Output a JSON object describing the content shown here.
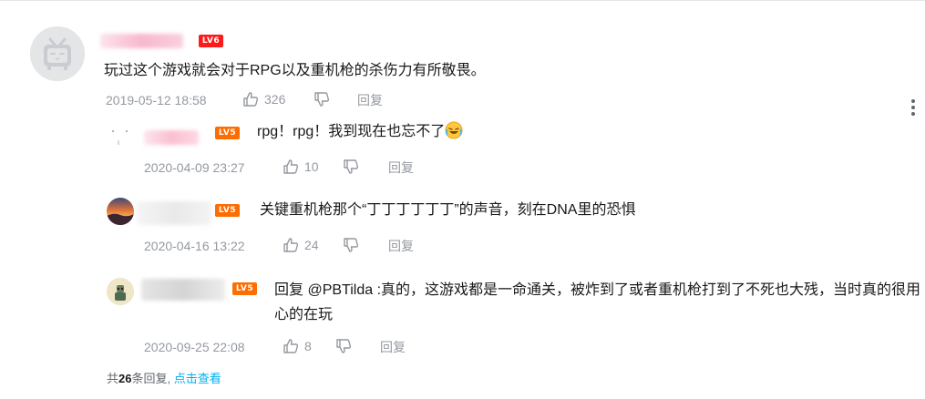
{
  "main_comment": {
    "level": "LV6",
    "content": "玩过这个游戏就会对于RPG以及重机枪的杀伤力有所敬畏。",
    "time": "2019-05-12 18:58",
    "likes": "326",
    "reply_label": "回复"
  },
  "replies": [
    {
      "level": "LV5",
      "content": "rpg！rpg！我到现在也忘不了",
      "emoji": "laughing-crying-emoji",
      "time": "2020-04-09 23:27",
      "likes": "10",
      "reply_label": "回复"
    },
    {
      "level": "LV5",
      "content": "关键重机枪那个“丁丁丁丁丁丁”的声音，刻在DNA里的恐惧",
      "time": "2020-04-16 13:22",
      "likes": "24",
      "reply_label": "回复"
    },
    {
      "level": "LV5",
      "content": "回复 @PBTilda :真的，这游戏都是一命通关，被炸到了或者重机枪打到了不死也大残，当时真的很用心的在玩",
      "time": "2020-09-25 22:08",
      "likes": "8",
      "reply_label": "回复"
    }
  ],
  "summary": {
    "prefix": "共",
    "count": "26",
    "suffix": "条回复,",
    "view_link": "点击查看"
  },
  "colors": {
    "accent": "#00aeec",
    "meta": "#9499a0",
    "lv6": "#ff1a1a",
    "lv5": "#ff6c00"
  }
}
